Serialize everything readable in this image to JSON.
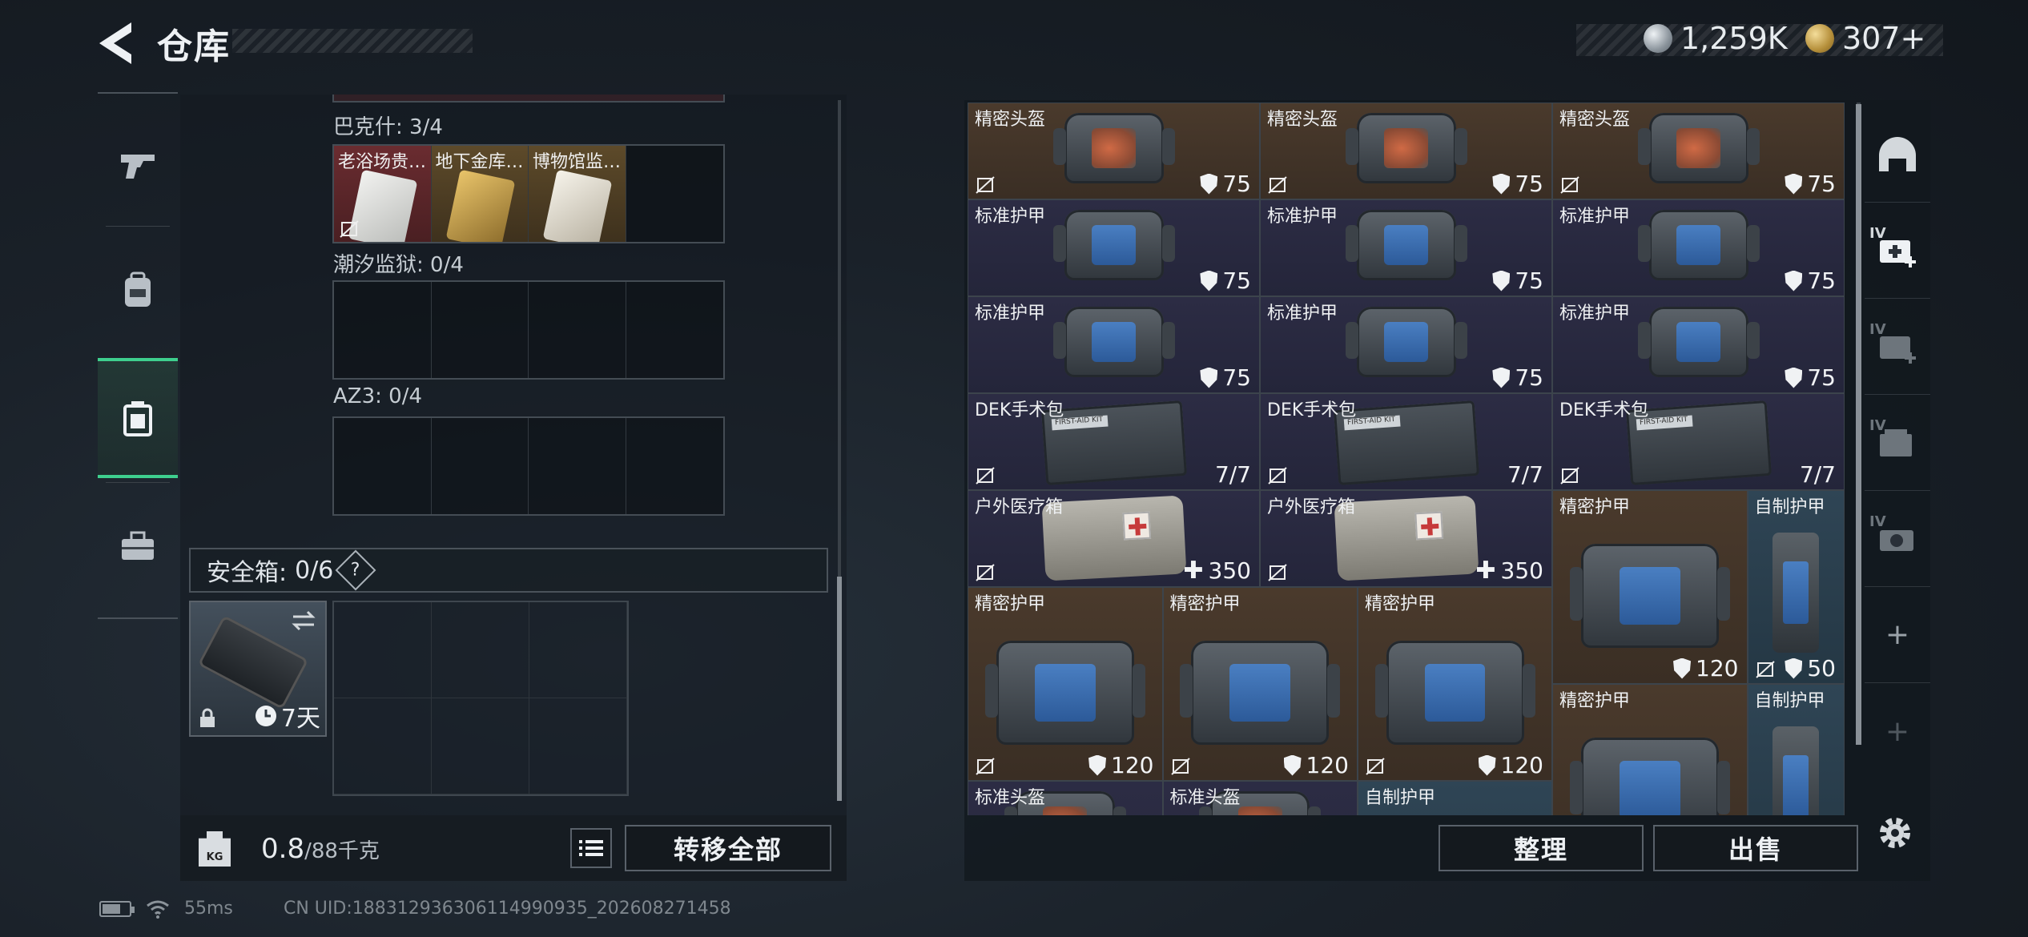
{
  "header": {
    "title": "仓库",
    "currency": [
      {
        "icon": "silver-coin-icon",
        "value": "1,259K"
      },
      {
        "icon": "gold-coin-icon",
        "value": "307+"
      }
    ]
  },
  "left_nav": {
    "items": [
      {
        "icon": "weapon-icon",
        "active": false
      },
      {
        "icon": "backpack-icon",
        "active": false
      },
      {
        "icon": "container-icon",
        "active": true
      },
      {
        "icon": "briefcase-icon",
        "active": false
      }
    ]
  },
  "stash": {
    "sets": [
      {
        "label": "巴克什: 3/4",
        "items": [
          "老浴场贵…",
          "地下金库…",
          "博物馆监…",
          ""
        ]
      },
      {
        "label": "潮汐监狱: 0/4",
        "items": []
      },
      {
        "label": "AZ3: 0/4",
        "items": []
      }
    ],
    "safe_box": {
      "label": "安全箱:",
      "count": "0/6",
      "help": "?",
      "timer": "7天"
    },
    "weight": {
      "current": "0.8",
      "capacity": "/88千克",
      "kg_icon_label": "KG"
    },
    "transfer_all_label": "转移全部"
  },
  "inventory": {
    "items": [
      {
        "name": "精密头盔",
        "value": "75",
        "kind": "armor"
      },
      {
        "name": "精密头盔",
        "value": "75",
        "kind": "armor"
      },
      {
        "name": "精密头盔",
        "value": "75",
        "kind": "armor"
      },
      {
        "name": "标准护甲",
        "value": "75",
        "kind": "armor"
      },
      {
        "name": "标准护甲",
        "value": "75",
        "kind": "armor"
      },
      {
        "name": "标准护甲",
        "value": "75",
        "kind": "armor"
      },
      {
        "name": "标准护甲",
        "value": "75",
        "kind": "armor"
      },
      {
        "name": "标准护甲",
        "value": "75",
        "kind": "armor"
      },
      {
        "name": "标准护甲",
        "value": "75",
        "kind": "armor"
      },
      {
        "name": "DEK手术包",
        "value": "7/7",
        "kind": "uses"
      },
      {
        "name": "DEK手术包",
        "value": "7/7",
        "kind": "uses"
      },
      {
        "name": "DEK手术包",
        "value": "7/7",
        "kind": "uses"
      },
      {
        "name": "户外医疗箱",
        "value": "350",
        "kind": "heal"
      },
      {
        "name": "户外医疗箱",
        "value": "350",
        "kind": "heal"
      },
      {
        "name": "精密护甲",
        "value": "120",
        "kind": "armor"
      },
      {
        "name": "自制护甲",
        "value": "50",
        "kind": "armor"
      },
      {
        "name": "精密护甲",
        "value": "120",
        "kind": "armor"
      },
      {
        "name": "精密护甲",
        "value": "120",
        "kind": "armor"
      },
      {
        "name": "精密护甲",
        "value": "120",
        "kind": "armor"
      },
      {
        "name": "精密护甲",
        "value": "",
        "kind": "armor"
      },
      {
        "name": "自制护甲",
        "value": "",
        "kind": "armor"
      },
      {
        "name": "标准头盔",
        "value": "",
        "kind": "armor"
      },
      {
        "name": "标准头盔",
        "value": "",
        "kind": "armor"
      },
      {
        "name": "自制护甲",
        "value": "",
        "kind": "armor"
      }
    ],
    "kit_strip_text": "FIRST-AID KIT",
    "sort_label": "整理",
    "sell_label": "出售"
  },
  "right_sidebar": {
    "tabs": [
      {
        "icon": "helmet-icon",
        "label": ""
      },
      {
        "icon": "medkit-add-icon",
        "label": "IV"
      },
      {
        "icon": "medkit-add-icon",
        "label": "IV"
      },
      {
        "icon": "storage-icon",
        "label": "IV"
      },
      {
        "icon": "camera-storage-icon",
        "label": "IV"
      },
      {
        "icon": "plus-icon",
        "label": "+"
      },
      {
        "icon": "plus-icon",
        "label": "+"
      }
    ]
  },
  "footer": {
    "ping": "55ms",
    "uid": "CN UID:18831293630611499093​5_202608271458"
  },
  "colors": {
    "accent": "#3ecf8e",
    "brown_bg": "#4a3a2c",
    "navy_bg": "#2c2c44",
    "steel_bg": "#2f4555"
  }
}
